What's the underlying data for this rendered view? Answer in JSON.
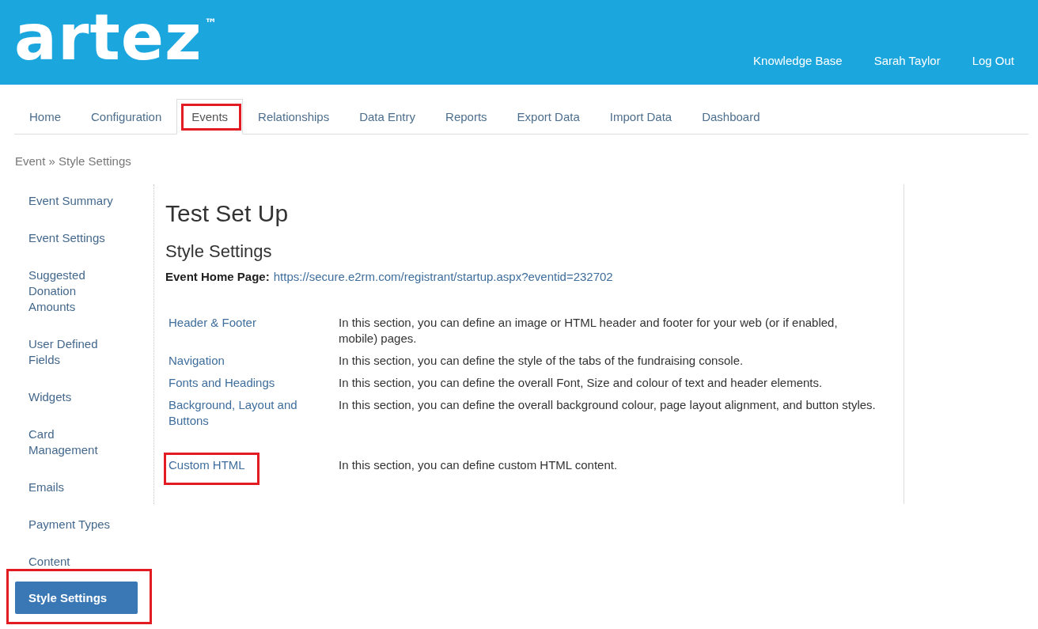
{
  "header": {
    "logo": "artez$^{™}$",
    "links": [
      "Knowledge Base",
      "Sarah Taylor",
      "Log Out"
    ]
  },
  "tabs": [
    {
      "label": "Home",
      "selected": false,
      "highlighted": false
    },
    {
      "label": "Configuration",
      "selected": false,
      "highlighted": false
    },
    {
      "label": "Events",
      "selected": true,
      "highlighted": true
    },
    {
      "label": "Relationships",
      "selected": false,
      "highlighted": false
    },
    {
      "label": "Data Entry",
      "selected": false,
      "highlighted": false
    },
    {
      "label": "Reports",
      "selected": false,
      "highlighted": false
    },
    {
      "label": "Export Data",
      "selected": false,
      "highlighted": false
    },
    {
      "label": "Import Data",
      "selected": false,
      "highlighted": false
    },
    {
      "label": "Dashboard",
      "selected": false,
      "highlighted": false
    }
  ],
  "breadcrumb": "Event » Style Settings",
  "sidebar": {
    "items": [
      {
        "label": "Event Summary",
        "selected": false,
        "highlighted": false
      },
      {
        "label": "Event Settings",
        "selected": false,
        "highlighted": false
      },
      {
        "label": "Suggested Donation Amounts",
        "selected": false,
        "highlighted": false
      },
      {
        "label": "User Defined Fields",
        "selected": false,
        "highlighted": false
      },
      {
        "label": "Widgets",
        "selected": false,
        "highlighted": false
      },
      {
        "label": "Card Management",
        "selected": false,
        "highlighted": false
      },
      {
        "label": "Emails",
        "selected": false,
        "highlighted": false
      },
      {
        "label": "Payment Types",
        "selected": false,
        "highlighted": false
      },
      {
        "label": "Content",
        "selected": false,
        "highlighted": false
      },
      {
        "label": "Style Settings",
        "selected": true,
        "highlighted": true
      }
    ]
  },
  "content": {
    "title": "Test Set Up",
    "subtitle": "Style Settings",
    "home_page": {
      "label": "Event Home Page:",
      "url": "https://secure.e2rm.com/registrant/startup.aspx?eventid=232702"
    },
    "groups": [
      {
        "rows": [
          {
            "link": "Header & Footer",
            "description": "In this section, you can define an image or HTML header and footer for your web (or if enabled, mobile) pages.",
            "highlighted": false
          },
          {
            "link": "Navigation",
            "description": "In this section, you can define the style of the tabs of the fundraising console.",
            "highlighted": false
          },
          {
            "link": "Fonts and Headings",
            "description": "In this section, you can define the overall Font, Size and colour of text and header elements.",
            "highlighted": false
          },
          {
            "link": "Background, Layout and Buttons",
            "description": "In this section, you can define the overall background colour, page layout alignment, and button styles.",
            "highlighted": false
          }
        ]
      },
      {
        "rows": [
          {
            "link": "Custom HTML",
            "description": "In this section, you can define custom HTML content.",
            "highlighted": true
          }
        ]
      }
    ]
  }
}
